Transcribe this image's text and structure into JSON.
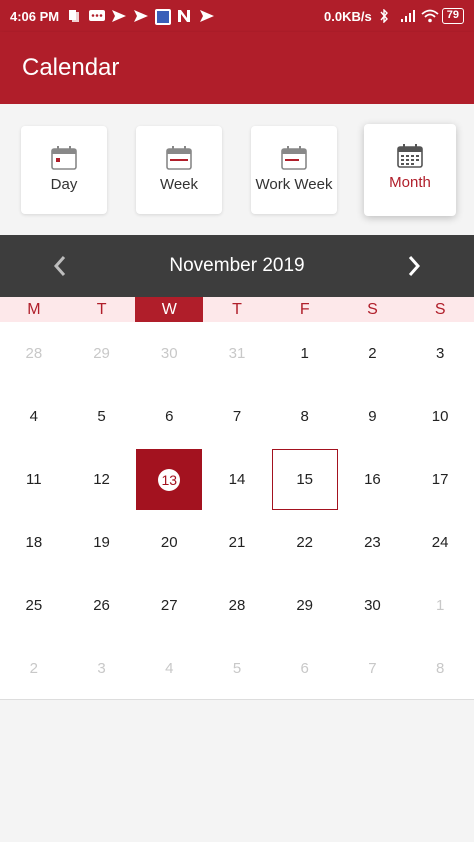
{
  "status_bar": {
    "time": "4:06 PM",
    "net_speed": "0.0KB/s",
    "battery": "79"
  },
  "app_bar": {
    "title": "Calendar"
  },
  "views": [
    {
      "label": "Day",
      "selected": false
    },
    {
      "label": "Week",
      "selected": false
    },
    {
      "label": "Work Week",
      "selected": false
    },
    {
      "label": "Month",
      "selected": true
    }
  ],
  "month_header": {
    "title": "November 2019"
  },
  "weekdays": [
    "M",
    "T",
    "W",
    "T",
    "F",
    "S",
    "S"
  ],
  "active_weekday_index": 2,
  "weeks": [
    [
      {
        "d": "28",
        "muted": true
      },
      {
        "d": "29",
        "muted": true
      },
      {
        "d": "30",
        "muted": true
      },
      {
        "d": "31",
        "muted": true
      },
      {
        "d": "1"
      },
      {
        "d": "2"
      },
      {
        "d": "3"
      }
    ],
    [
      {
        "d": "4"
      },
      {
        "d": "5"
      },
      {
        "d": "6"
      },
      {
        "d": "7"
      },
      {
        "d": "8"
      },
      {
        "d": "9"
      },
      {
        "d": "10"
      }
    ],
    [
      {
        "d": "11"
      },
      {
        "d": "12"
      },
      {
        "d": "13",
        "selected": true
      },
      {
        "d": "14"
      },
      {
        "d": "15",
        "today": true
      },
      {
        "d": "16"
      },
      {
        "d": "17"
      }
    ],
    [
      {
        "d": "18"
      },
      {
        "d": "19"
      },
      {
        "d": "20"
      },
      {
        "d": "21"
      },
      {
        "d": "22"
      },
      {
        "d": "23"
      },
      {
        "d": "24"
      }
    ],
    [
      {
        "d": "25"
      },
      {
        "d": "26"
      },
      {
        "d": "27"
      },
      {
        "d": "28"
      },
      {
        "d": "29"
      },
      {
        "d": "30"
      },
      {
        "d": "1",
        "muted": true
      }
    ],
    [
      {
        "d": "2",
        "muted": true
      },
      {
        "d": "3",
        "muted": true
      },
      {
        "d": "4",
        "muted": true
      },
      {
        "d": "5",
        "muted": true
      },
      {
        "d": "6",
        "muted": true
      },
      {
        "d": "7",
        "muted": true
      },
      {
        "d": "8",
        "muted": true
      }
    ]
  ],
  "colors": {
    "brand": "#b01e2a",
    "selected": "#a3121f",
    "header_dark": "#3d3d3d",
    "weekday_bg": "#fde8ea"
  },
  "icons": [
    "calendar-icon",
    "chevron-left-icon",
    "chevron-right-icon",
    "wifi-icon",
    "signal-icon",
    "bluetooth-icon",
    "battery-icon"
  ]
}
